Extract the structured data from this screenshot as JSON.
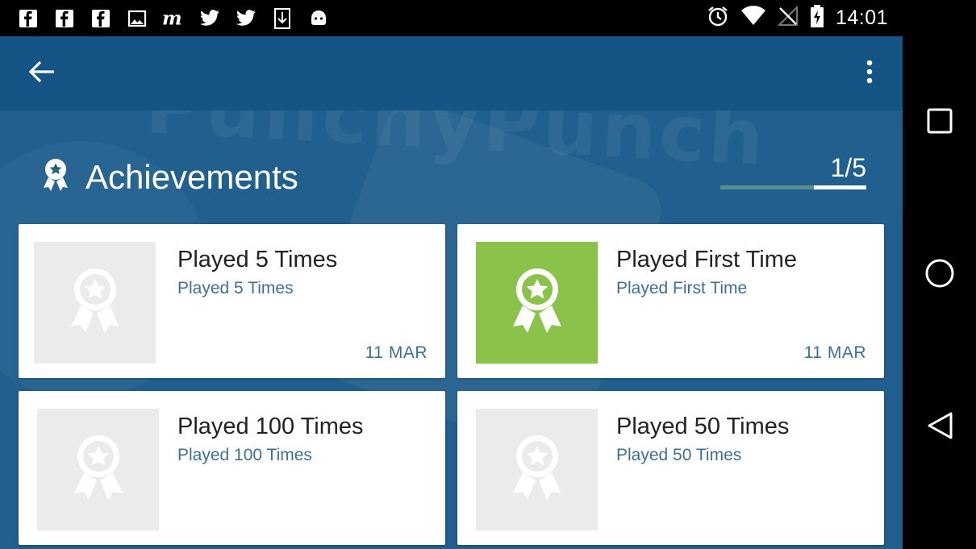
{
  "status_bar": {
    "time": "14:01",
    "notification_icons": [
      "facebook-icon",
      "facebook-icon",
      "facebook-icon",
      "image-icon",
      "messenger-icon",
      "twitter-icon",
      "twitter-icon",
      "download-icon",
      "android-icon"
    ],
    "system_icons": [
      "alarm-icon",
      "wifi-icon",
      "no-signal-icon",
      "battery-charging-icon"
    ]
  },
  "toolbar": {
    "back_icon": "arrow-left-icon",
    "menu_icon": "more-vert-icon"
  },
  "background_logo": "PunchyPunch",
  "achievements": {
    "title": "Achievements",
    "progress_text": "1/5",
    "progress_fraction": 0.2,
    "items": [
      {
        "title": "Played 5 Times",
        "description": "Played 5 Times",
        "date": "11 MAR",
        "unlocked": false
      },
      {
        "title": "Played First Time",
        "description": "Played First Time",
        "date": "11 MAR",
        "unlocked": true
      },
      {
        "title": "Played 100 Times",
        "description": "Played 100 Times",
        "date": "",
        "unlocked": false
      },
      {
        "title": "Played 50 Times",
        "description": "Played 50 Times",
        "date": "",
        "unlocked": false
      }
    ]
  },
  "colors": {
    "toolbar": "#155586",
    "background": "#215f8e",
    "unlocked_badge": "#8bc34a",
    "locked_badge": "#ebebeb",
    "secondary_text": "#3d6f99"
  },
  "nav_bar": {
    "buttons": [
      "recents-icon",
      "home-icon",
      "back-triangle-icon"
    ]
  }
}
